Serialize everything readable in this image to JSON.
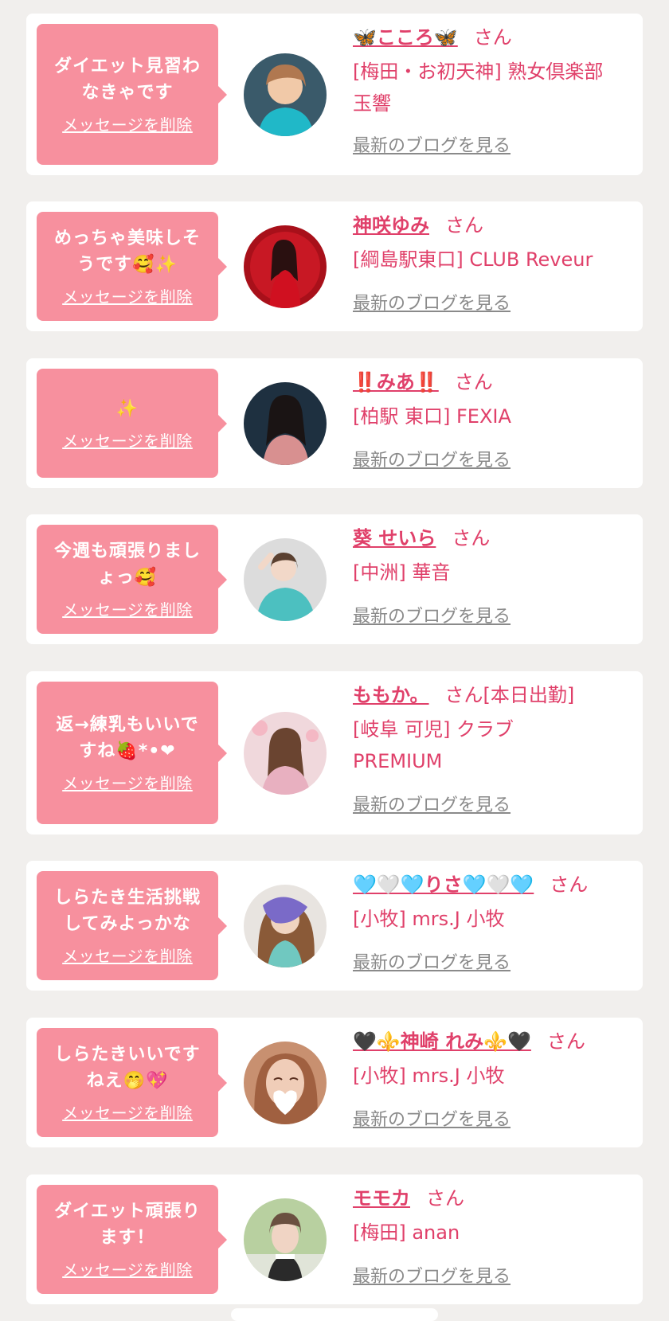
{
  "delete_label": "メッセージを削除",
  "blog_label": "最新のブログを見る",
  "san_label": "さん",
  "cards": [
    {
      "message": "ダイエット見習わ\nなきゃです",
      "name": "🦋こころ🦋",
      "suffix": "",
      "shop": "[梅田・お初天神] 熟女倶楽部\n玉響"
    },
    {
      "message": "めっちゃ美味しそ\nうです🥰✨",
      "name": "神咲ゆみ",
      "suffix": "",
      "shop": "[綱島駅東口] CLUB Reveur"
    },
    {
      "message": "✨",
      "name": "‼️みあ‼️",
      "suffix": "",
      "shop": "[柏駅 東口] FEXIA"
    },
    {
      "message": "今週も頑張りまし\nょっ🥰",
      "name": "葵 せいら",
      "suffix": "",
      "shop": "[中洲] 華音"
    },
    {
      "message": "返→練乳もいいで\nすね🍓*•❤",
      "name": "ももか。",
      "suffix": "[本日出勤]",
      "shop": "[岐阜 可児] クラブ\nPREMIUM"
    },
    {
      "message": "しらたき生活挑戦\nしてみよっかな",
      "name": "🩵🤍🩵りさ🩵🤍🩵",
      "suffix": "",
      "shop": "[小牧] mrs.J 小牧"
    },
    {
      "message": "しらたきいいです\nねえ🤭💖",
      "name": "🖤⚜️神崎 れみ⚜️🖤",
      "suffix": "",
      "shop": "[小牧] mrs.J 小牧"
    },
    {
      "message": "ダイエット頑張り\nます！",
      "name": "モモカ",
      "suffix": "",
      "shop": "[梅田] anan"
    }
  ],
  "colors": {
    "accent": "#e0406a",
    "bubble": "#f7909e",
    "background": "#f1efed",
    "link_gray": "#8a8a8a"
  }
}
